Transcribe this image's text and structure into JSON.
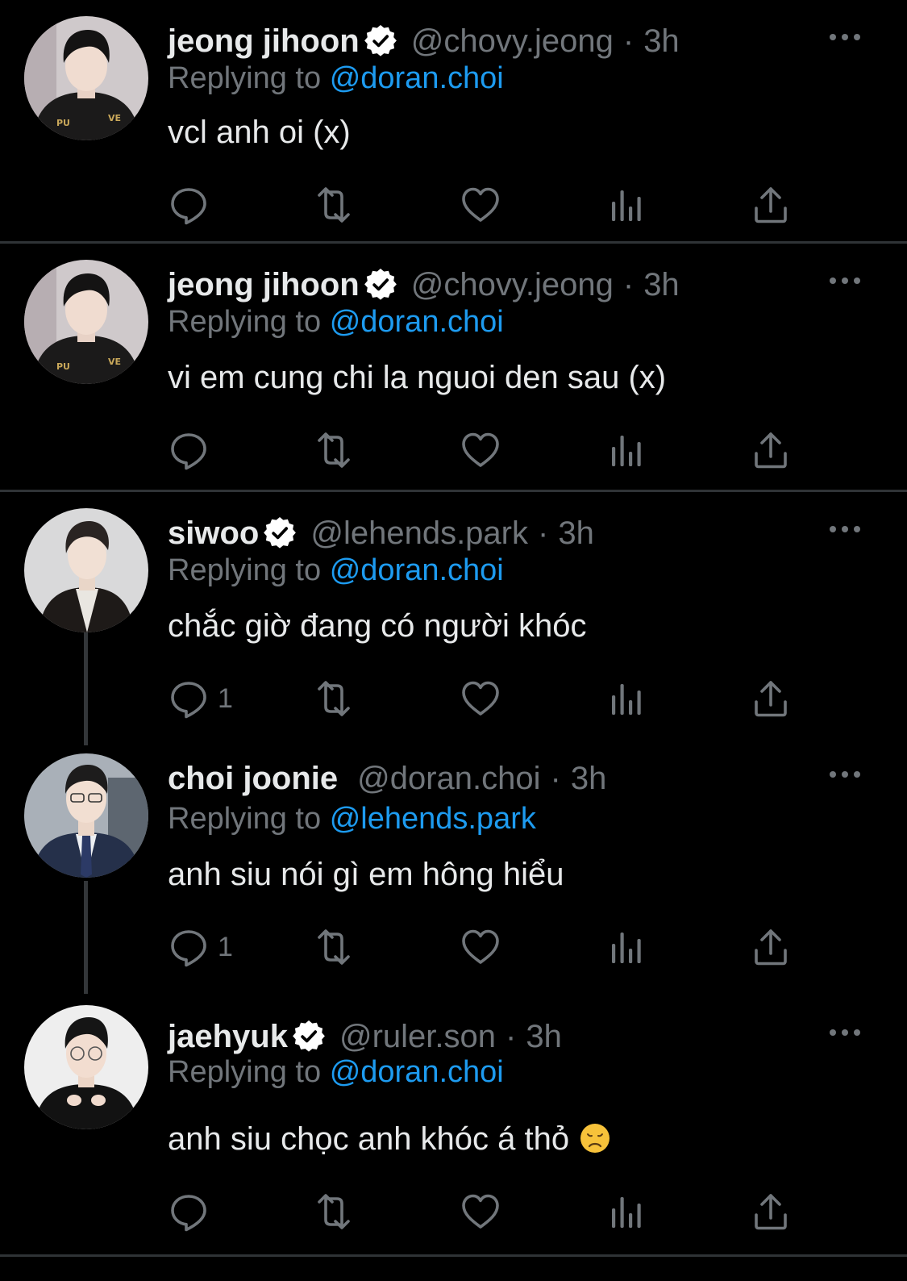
{
  "replying_prefix": "Replying to",
  "tweets": [
    {
      "name": "jeong jihoon",
      "verified": true,
      "handle": "@chovy.jeong",
      "separator": "·",
      "time": "3h",
      "replying_to": "@doran.choi",
      "text": "vcl anh oi (x)",
      "reply_count": ""
    },
    {
      "name": "jeong jihoon",
      "verified": true,
      "handle": "@chovy.jeong",
      "separator": "·",
      "time": "3h",
      "replying_to": "@doran.choi",
      "text": "vi em cung chi la nguoi den sau (x)",
      "reply_count": ""
    },
    {
      "name": "siwoo",
      "verified": true,
      "handle": "@lehends.park",
      "separator": "·",
      "time": "3h",
      "replying_to": "@doran.choi",
      "text": "chắc giờ đang có người khóc",
      "reply_count": "1"
    },
    {
      "name": "choi joonie",
      "verified": false,
      "handle": "@doran.choi",
      "separator": "·",
      "time": "3h",
      "replying_to": "@lehends.park",
      "text": "anh siu nói gì em hông hiểu",
      "reply_count": "1"
    },
    {
      "name": "jaehyuk",
      "verified": true,
      "handle": "@ruler.son",
      "separator": "·",
      "time": "3h",
      "replying_to": "@doran.choi",
      "text": "anh siu chọc anh khóc á thỏ",
      "emoji": "disappointed-face-emoji",
      "reply_count": ""
    }
  ],
  "icons": {
    "reply": "reply-icon",
    "retweet": "retweet-icon",
    "like": "like-icon",
    "views": "views-icon",
    "share": "share-icon",
    "more": "more-icon",
    "verified": "verified-badge-icon"
  },
  "colors": {
    "background": "#000000",
    "text": "#e7e9ea",
    "muted": "#71767b",
    "mention": "#1d9bf0",
    "divider": "#2f3336"
  }
}
